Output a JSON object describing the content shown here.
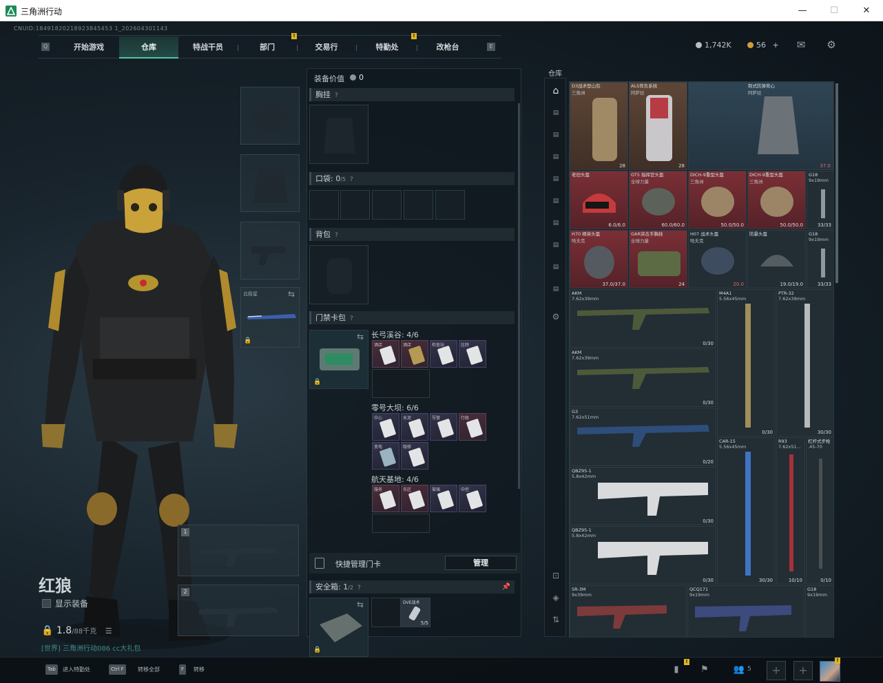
{
  "window": {
    "title": "三角洲行动",
    "controls": [
      "—",
      "☐",
      "✕"
    ]
  },
  "uid": "CNUID:18491820218923845453 1_202604301143",
  "nav": {
    "tabs": [
      "开始游戏",
      "仓库",
      "特战干员",
      "部门",
      "交易行",
      "特勤处",
      "改枪台"
    ],
    "active": "仓库",
    "left_key": "Q",
    "right_key": "E",
    "badge": "!"
  },
  "currency": {
    "coins": "1,742K",
    "tickets": "56",
    "tickets_add": "+"
  },
  "operator": {
    "name": "红狼",
    "show_equipment": "显示装备",
    "weight": "1.8",
    "weight_max": "/88千克",
    "promo": "[世界] 三角洲行动086 cc大礼包",
    "melee_label": "北极星",
    "weapon_slot_1": "1",
    "weapon_slot_2": "2"
  },
  "equipment": {
    "header": "装备价值",
    "value": "0",
    "chest_rig": "胸挂",
    "pockets": "口袋:",
    "pockets_count": "0",
    "pockets_max": "/5",
    "backpack": "背包",
    "keycard_bag": "门禁卡包",
    "help": "?",
    "maps": [
      {
        "name": "长弓溪谷: 4/6",
        "cards": [
          "酒店",
          "酒店",
          "检查站",
          "比特"
        ]
      },
      {
        "name": "零号大坝: 6/6",
        "cards": [
          "中心",
          "水泥",
          "军营",
          "行政",
          "变电",
          "隐修"
        ]
      },
      {
        "name": "航天基地: 4/6",
        "cards": [
          "服务",
          "东区",
          "玻璃",
          "中控"
        ]
      }
    ],
    "quick_manage": "快捷管理门卡",
    "manage_btn": "管理",
    "safe_box": "安全箱:",
    "safe_box_count": "1",
    "safe_box_max": "/2",
    "safe_item": "DVE战术",
    "safe_item_stat": "5/5"
  },
  "warehouse": {
    "title": "仓库",
    "side_tabs": [
      "home",
      "1",
      "2",
      "3",
      "4",
      "5",
      "6",
      "7",
      "8",
      "9",
      "10"
    ],
    "items": {
      "bag1": {
        "name": "D3战术登山包",
        "sub": "三角洲",
        "stat": "28"
      },
      "bag2": {
        "name": "ALS背负系统",
        "sub": "阿萨拉",
        "stat": "28"
      },
      "vest": {
        "name": "制式防弹背心",
        "sub": "阿萨拉",
        "stat": "37.0"
      },
      "h1": {
        "name": "老旧头盔",
        "stat": "6.0/6.0"
      },
      "h2": {
        "name": "GT5 指挥官头盔",
        "sub": "全球力量",
        "stat": "60.0/60.0"
      },
      "h3": {
        "name": "DICH-9重型头盔",
        "sub": "三角洲",
        "stat": "50.0/50.0"
      },
      "h4": {
        "name": "DICH-9重型头盔",
        "sub": "三角洲",
        "stat": "50.0/50.0"
      },
      "g18a": {
        "name": "G18",
        "sub": "9x19mm",
        "stat": "33/33"
      },
      "h5": {
        "name": "H70 精英头盔",
        "sub": "哈夫克",
        "stat": "37.0/37.0"
      },
      "bag3": {
        "name": "GAR突击手胸挂",
        "sub": "全球力量",
        "stat": "24"
      },
      "h6": {
        "name": "H07 战术头盔",
        "sub": "哈夫克",
        "stat": "20.0"
      },
      "h7": {
        "name": "防暴头盔",
        "stat": "19.0/19.0"
      },
      "g18b": {
        "name": "G18",
        "sub": "9x19mm",
        "stat": "33/33"
      },
      "akm1": {
        "name": "AKM",
        "sub": "7.62x39mm",
        "stat": "0/30"
      },
      "m4a1": {
        "name": "M4A1",
        "sub": "5.56x45mm",
        "stat": "0/30"
      },
      "ptr": {
        "name": "PTR-32",
        "sub": "7.62x39mm",
        "stat": "30/30"
      },
      "akm2": {
        "name": "AKM",
        "sub": "7.62x39mm",
        "stat": "0/30"
      },
      "g3": {
        "name": "G3",
        "sub": "7.62x51mm",
        "stat": "0/20"
      },
      "car15": {
        "name": "CAR-15",
        "sub": "5.56x45mm",
        "stat": "30/30"
      },
      "r93": {
        "name": "R93",
        "sub": "7.62x51...",
        "stat": "10/10"
      },
      "lever": {
        "name": "杠杆式步枪",
        "sub": ".45-70",
        "stat": "0/10"
      },
      "qbz1": {
        "name": "QBZ95-1",
        "sub": "5.8x42mm",
        "stat": "0/30"
      },
      "qbz2": {
        "name": "QBZ95-1",
        "sub": "5.8x42mm",
        "stat": "0/30"
      },
      "sr3m": {
        "name": "SR-3M",
        "sub": "9x39mm"
      },
      "qcq": {
        "name": "QCQ171",
        "sub": "9x19mm"
      },
      "g18c": {
        "name": "G18",
        "sub": "9x19mm"
      }
    }
  },
  "bottom": {
    "k1": "Tab",
    "k1_label": "进入特勤处",
    "k2": "Ctrl F",
    "k2_label": "转移全部",
    "k3": "F",
    "k3_label": "转移",
    "friends": "5"
  }
}
